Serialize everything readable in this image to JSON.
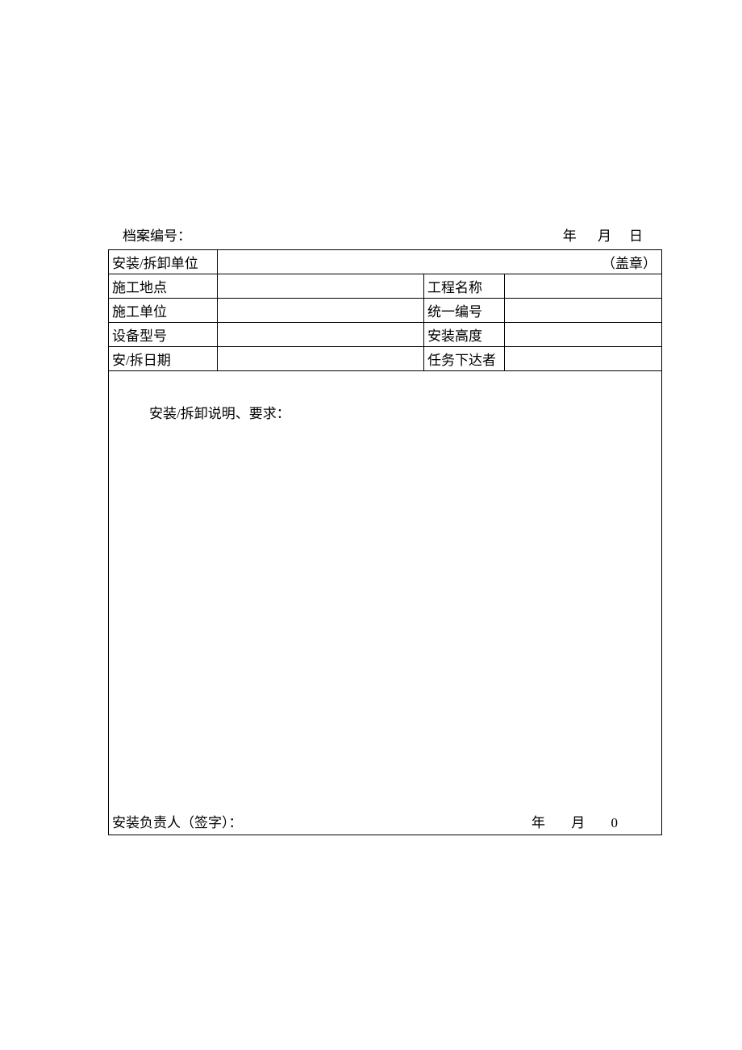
{
  "header": {
    "file_no_label": "档案编号：",
    "year_label": "年",
    "month_label": "月",
    "day_label": "日"
  },
  "table": {
    "unit_label": "安装/拆卸单位",
    "seal_label": "（盖章）",
    "site_label": "施工地点",
    "project_label": "工程名称",
    "construction_unit_label": "施工单位",
    "unified_no_label": "统一编号",
    "model_label": "设备型号",
    "height_label": "安装高度",
    "date_label": "安/拆日期",
    "task_issuer_label": "任务下达者",
    "unit_value": "",
    "site_value": "",
    "project_value": "",
    "construction_unit_value": "",
    "unified_no_value": "",
    "model_value": "",
    "height_value": "",
    "date_value": "",
    "task_issuer_value": ""
  },
  "box": {
    "title": "安装/拆卸说明、要求：",
    "footer_sign_label": "安装负责人（签字）：",
    "footer_year_label": "年",
    "footer_month_label": "月",
    "footer_zero": "0"
  }
}
